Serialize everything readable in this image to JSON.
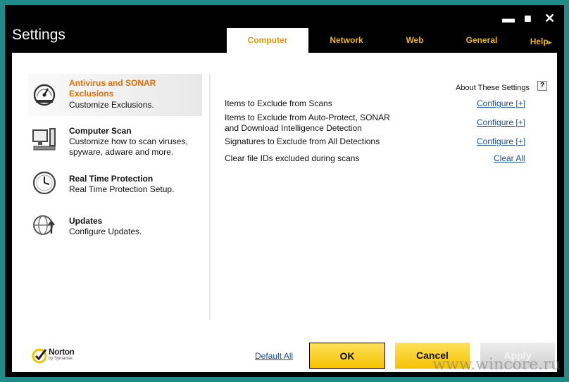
{
  "window": {
    "title": "Settings",
    "minimize_glyph": "▬",
    "maximize_glyph": "■",
    "close_glyph": "✕"
  },
  "tabs": [
    {
      "label": "Computer",
      "active": true
    },
    {
      "label": "Network",
      "active": false
    },
    {
      "label": "Web",
      "active": false
    },
    {
      "label": "General",
      "active": false
    }
  ],
  "help": {
    "label": "Help",
    "glyph": "▸"
  },
  "sidebar": {
    "items": [
      {
        "title": "Antivirus and SONAR Exclusions",
        "title_line1": "Antivirus and SONAR",
        "title_line2": "Exclusions",
        "desc": "Customize Exclusions.",
        "active": true,
        "icon": "gauge-icon"
      },
      {
        "title": "Computer Scan",
        "desc_line1": "Customize how to scan viruses,",
        "desc_line2": "spyware, adware and more.",
        "active": false,
        "icon": "computer-icon"
      },
      {
        "title": "Real Time Protection",
        "desc": "Real Time Protection Setup.",
        "active": false,
        "icon": "clock-icon"
      },
      {
        "title": "Updates",
        "desc": "Configure Updates.",
        "active": false,
        "icon": "globe-icon"
      }
    ]
  },
  "main": {
    "about_label": "About These Settings",
    "about_help": "?",
    "rows": [
      {
        "label": "Items to Exclude from Scans",
        "link": "Configure [+]"
      },
      {
        "label_line1": "Items to Exclude from Auto-Protect, SONAR",
        "label_line2": "and Download Intelligence Detection",
        "link": "Configure [+]"
      },
      {
        "label": "Signatures to Exclude from All Detections",
        "link": "Configure [+]"
      },
      {
        "label": "Clear file IDs excluded during scans",
        "link": "Clear All"
      }
    ]
  },
  "footer": {
    "brand": "Norton",
    "brand_sub": "by Symantec",
    "default_all": "Default All",
    "ok": "OK",
    "cancel": "Cancel",
    "apply": "Apply"
  },
  "watermark": "www.wincore.ru",
  "colors": {
    "accent": "#f5c200",
    "active_tab_text": "#e69500",
    "selected_item_title": "#e66d00",
    "link": "#1a4f8b",
    "desktop": "#1f8c8a"
  }
}
